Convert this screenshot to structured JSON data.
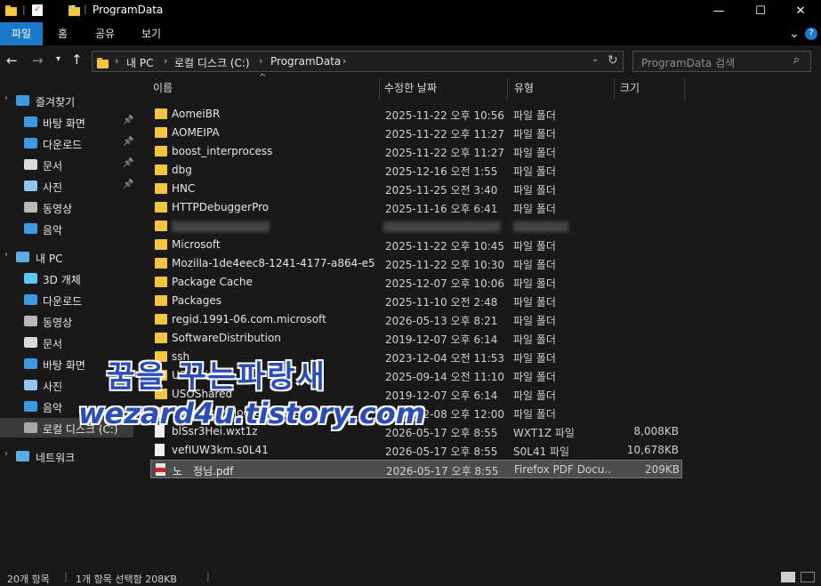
{
  "window": {
    "title": "ProgramData",
    "minimize": "—",
    "maximize": "☐",
    "close": "✕"
  },
  "ribbon": {
    "tabs": [
      "파일",
      "홈",
      "공유",
      "보기"
    ],
    "expand": "⌄",
    "help": "?"
  },
  "address": {
    "crumbs": [
      "내 PC",
      "로컬 디스크 (C:)",
      "ProgramData"
    ],
    "search_placeholder": "ProgramData 검색"
  },
  "sidebar": {
    "items": [
      {
        "label": "즐겨찾기",
        "icon": "star-icon",
        "pinned": false
      },
      {
        "label": "바탕 화면",
        "icon": "desktop-icon",
        "pinned": true
      },
      {
        "label": "다운로드",
        "icon": "download-icon",
        "pinned": true
      },
      {
        "label": "문서",
        "icon": "documents-icon",
        "pinned": true
      },
      {
        "label": "사진",
        "icon": "pictures-icon",
        "pinned": true
      },
      {
        "label": "동영상",
        "icon": "videos-icon",
        "pinned": false
      },
      {
        "label": "음악",
        "icon": "music-icon",
        "pinned": false
      },
      {
        "label": "내 PC",
        "icon": "this-pc-icon",
        "pinned": false
      },
      {
        "label": "3D 개체",
        "icon": "3d-objects-icon",
        "pinned": false
      },
      {
        "label": "다운로드",
        "icon": "download-icon",
        "pinned": false
      },
      {
        "label": "동영상",
        "icon": "videos-icon",
        "pinned": false
      },
      {
        "label": "문서",
        "icon": "documents-icon",
        "pinned": false
      },
      {
        "label": "바탕 화면",
        "icon": "desktop-icon",
        "pinned": false
      },
      {
        "label": "사진",
        "icon": "pictures-icon",
        "pinned": false
      },
      {
        "label": "음악",
        "icon": "music-icon",
        "pinned": false
      },
      {
        "label": "로컬 디스크 (C:)",
        "icon": "drive-icon",
        "pinned": false
      },
      {
        "label": "네트워크",
        "icon": "network-icon",
        "pinned": false
      }
    ]
  },
  "columns": {
    "name": "이름",
    "date": "수정한 날짜",
    "type": "유형",
    "size": "크기"
  },
  "files": [
    {
      "name": "AomeiBR",
      "date": "2025-11-22 오후 10:56",
      "type": "파일 폴더",
      "size": "",
      "kind": "folder"
    },
    {
      "name": "AOMEIPA",
      "date": "2025-11-22 오후 11:27",
      "type": "파일 폴더",
      "size": "",
      "kind": "folder"
    },
    {
      "name": "boost_interprocess",
      "date": "2025-11-22 오후 11:27",
      "type": "파일 폴더",
      "size": "",
      "kind": "folder"
    },
    {
      "name": "dbg",
      "date": "2025-12-16 오전 1:55",
      "type": "파일 폴더",
      "size": "",
      "kind": "folder"
    },
    {
      "name": "HNC",
      "date": "2025-11-25 오전 3:40",
      "type": "파일 폴더",
      "size": "",
      "kind": "folder"
    },
    {
      "name": "HTTPDebuggerPro",
      "date": "2025-11-16 오후 6:41",
      "type": "파일 폴더",
      "size": "",
      "kind": "folder"
    },
    {
      "name": "",
      "date": "",
      "type": "",
      "size": "",
      "kind": "redacted"
    },
    {
      "name": "Microsoft",
      "date": "2025-11-22 오후 10:45",
      "type": "파일 폴더",
      "size": "",
      "kind": "folder"
    },
    {
      "name": "Mozilla-1de4eec8-1241-4177-a864-e5...",
      "date": "2025-11-22 오후 10:30",
      "type": "파일 폴더",
      "size": "",
      "kind": "folder"
    },
    {
      "name": "Package Cache",
      "date": "2025-12-07 오후 10:06",
      "type": "파일 폴더",
      "size": "",
      "kind": "folder"
    },
    {
      "name": "Packages",
      "date": "2025-11-10 오전 2:48",
      "type": "파일 폴더",
      "size": "",
      "kind": "folder"
    },
    {
      "name": "regid.1991-06.com.microsoft",
      "date": "2026-05-13 오후 8:21",
      "type": "파일 폴더",
      "size": "",
      "kind": "folder"
    },
    {
      "name": "SoftwareDistribution",
      "date": "2019-12-07 오후 6:14",
      "type": "파일 폴더",
      "size": "",
      "kind": "folder"
    },
    {
      "name": "ssh",
      "date": "2023-12-04 오전 11:53",
      "type": "파일 폴더",
      "size": "",
      "kind": "folder"
    },
    {
      "name": "USOPrivate",
      "date": "2025-09-14 오전 11:10",
      "type": "파일 폴더",
      "size": "",
      "kind": "folder"
    },
    {
      "name": "USOShared",
      "date": "2019-12-07 오후 6:14",
      "type": "파일 폴더",
      "size": "",
      "kind": "folder"
    },
    {
      "name": "WindowsHolographicDevices",
      "date": "2019-12-08 오후 12:00",
      "type": "파일 폴더",
      "size": "",
      "kind": "folder"
    },
    {
      "name": "blSsr3Hei.wxt1z",
      "date": "2026-05-17 오후 8:55",
      "type": "WXT1Z 파일",
      "size": "8,008KB",
      "kind": "file"
    },
    {
      "name": "vefIUW3km.s0L41",
      "date": "2026-05-17 오후 8:55",
      "type": "S0L41 파일",
      "size": "10,678KB",
      "kind": "file"
    },
    {
      "name": "노　정님.pdf",
      "date": "2026-05-17 오후 8:55",
      "type": "Firefox PDF Docu...",
      "size": "209KB",
      "kind": "pdf"
    }
  ],
  "status": {
    "count": "20개 항목",
    "selection": "1개 항목 선택함 208KB"
  },
  "watermark": {
    "line1": "꿈을 꾸는파랑새",
    "line2": "wezard4u.tistory.com"
  },
  "colors": {
    "accent": "#1979ca",
    "folder": "#f5c542",
    "background": "#191919"
  }
}
